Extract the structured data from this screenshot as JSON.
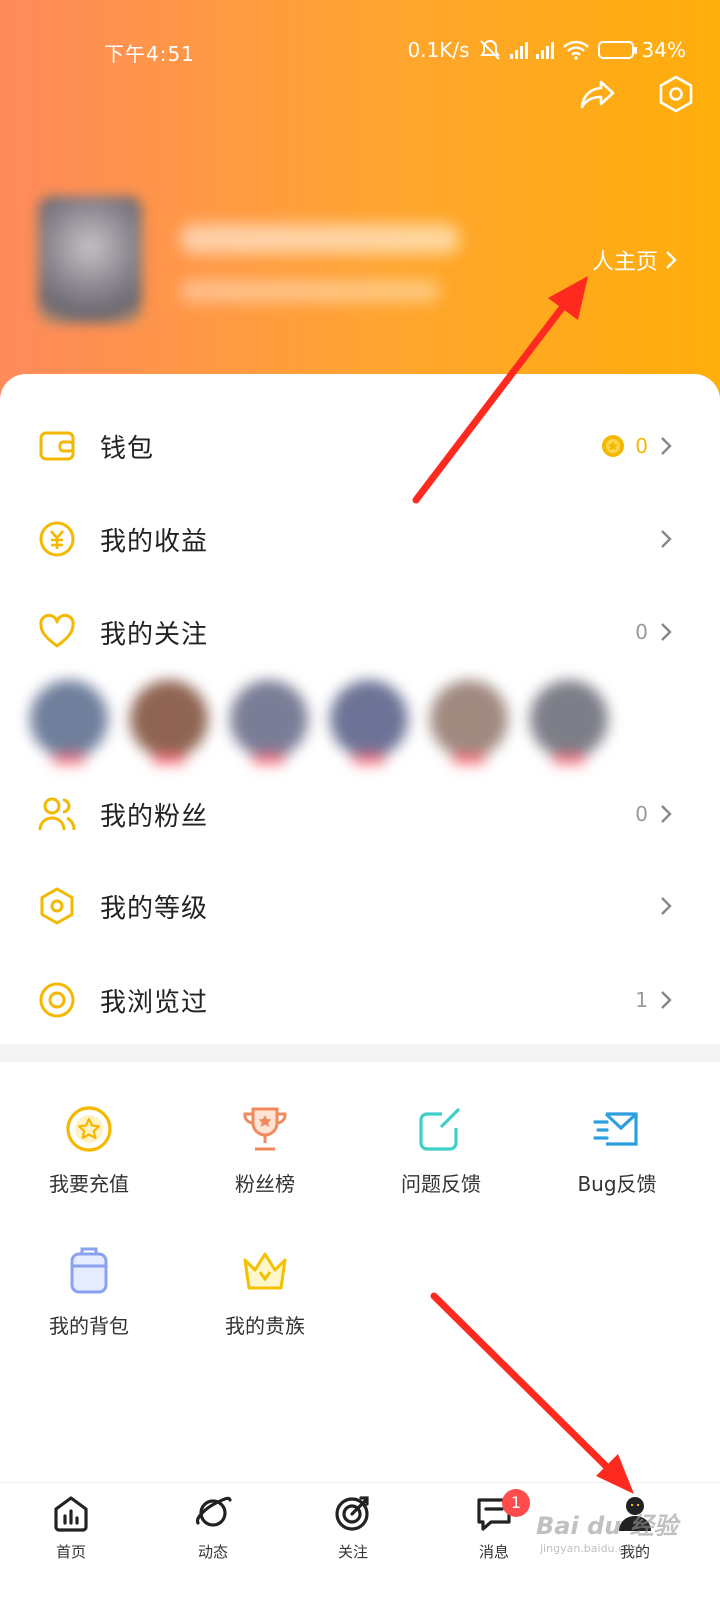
{
  "status_bar": {
    "time": "下午4:51",
    "speed": "0.1K/s",
    "battery": "34%",
    "battery_level": 0.34
  },
  "profile": {
    "home_link": "人主页"
  },
  "menu": [
    {
      "id": "wallet",
      "label": "钱包",
      "value": "0",
      "icon": "wallet-icon"
    },
    {
      "id": "earnings",
      "label": "我的收益",
      "value": "",
      "icon": "yuan-coin-icon"
    },
    {
      "id": "following",
      "label": "我的关注",
      "value": "0",
      "icon": "heart-icon"
    },
    {
      "id": "fans",
      "label": "我的粉丝",
      "value": "0",
      "icon": "users-icon"
    },
    {
      "id": "level",
      "label": "我的等级",
      "value": "",
      "icon": "hexagon-icon"
    },
    {
      "id": "history",
      "label": "我浏览过",
      "value": "1",
      "icon": "eye-icon"
    }
  ],
  "grid": [
    {
      "label": "我要充值",
      "icon": "recharge-icon"
    },
    {
      "label": "粉丝榜",
      "icon": "trophy-icon"
    },
    {
      "label": "问题反馈",
      "icon": "edit-feedback-icon"
    },
    {
      "label": "Bug反馈",
      "icon": "bug-report-icon"
    },
    {
      "label": "我的背包",
      "icon": "backpack-icon"
    },
    {
      "label": "我的贵族",
      "icon": "crown-icon"
    }
  ],
  "tabs": [
    {
      "label": "首页",
      "icon": "home-chart-icon"
    },
    {
      "label": "动态",
      "icon": "planet-icon"
    },
    {
      "label": "关注",
      "icon": "target-icon"
    },
    {
      "label": "消息",
      "icon": "message-icon",
      "badge": "1"
    },
    {
      "label": "我的",
      "icon": "profile-icon"
    }
  ],
  "watermark": {
    "brand": "Bai du 经验",
    "url": "jingyan.baidu.com"
  },
  "colors": {
    "header_from": "#ff8a5c",
    "header_to": "#ffae0a",
    "accent": "#f5b800",
    "badge": "#ff4b4b"
  }
}
